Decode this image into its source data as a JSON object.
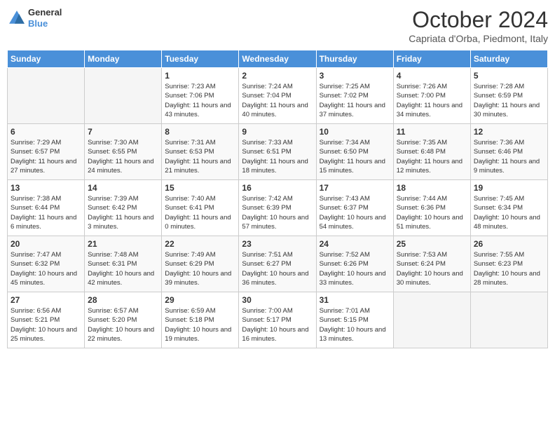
{
  "header": {
    "logo_line1": "General",
    "logo_line2": "Blue",
    "month_title": "October 2024",
    "subtitle": "Capriata d'Orba, Piedmont, Italy"
  },
  "days_of_week": [
    "Sunday",
    "Monday",
    "Tuesday",
    "Wednesday",
    "Thursday",
    "Friday",
    "Saturday"
  ],
  "weeks": [
    [
      {
        "day": null
      },
      {
        "day": null
      },
      {
        "day": 1,
        "sunrise": "7:23 AM",
        "sunset": "7:06 PM",
        "daylight": "11 hours and 43 minutes."
      },
      {
        "day": 2,
        "sunrise": "7:24 AM",
        "sunset": "7:04 PM",
        "daylight": "11 hours and 40 minutes."
      },
      {
        "day": 3,
        "sunrise": "7:25 AM",
        "sunset": "7:02 PM",
        "daylight": "11 hours and 37 minutes."
      },
      {
        "day": 4,
        "sunrise": "7:26 AM",
        "sunset": "7:00 PM",
        "daylight": "11 hours and 34 minutes."
      },
      {
        "day": 5,
        "sunrise": "7:28 AM",
        "sunset": "6:59 PM",
        "daylight": "11 hours and 30 minutes."
      }
    ],
    [
      {
        "day": 6,
        "sunrise": "7:29 AM",
        "sunset": "6:57 PM",
        "daylight": "11 hours and 27 minutes."
      },
      {
        "day": 7,
        "sunrise": "7:30 AM",
        "sunset": "6:55 PM",
        "daylight": "11 hours and 24 minutes."
      },
      {
        "day": 8,
        "sunrise": "7:31 AM",
        "sunset": "6:53 PM",
        "daylight": "11 hours and 21 minutes."
      },
      {
        "day": 9,
        "sunrise": "7:33 AM",
        "sunset": "6:51 PM",
        "daylight": "11 hours and 18 minutes."
      },
      {
        "day": 10,
        "sunrise": "7:34 AM",
        "sunset": "6:50 PM",
        "daylight": "11 hours and 15 minutes."
      },
      {
        "day": 11,
        "sunrise": "7:35 AM",
        "sunset": "6:48 PM",
        "daylight": "11 hours and 12 minutes."
      },
      {
        "day": 12,
        "sunrise": "7:36 AM",
        "sunset": "6:46 PM",
        "daylight": "11 hours and 9 minutes."
      }
    ],
    [
      {
        "day": 13,
        "sunrise": "7:38 AM",
        "sunset": "6:44 PM",
        "daylight": "11 hours and 6 minutes."
      },
      {
        "day": 14,
        "sunrise": "7:39 AM",
        "sunset": "6:42 PM",
        "daylight": "11 hours and 3 minutes."
      },
      {
        "day": 15,
        "sunrise": "7:40 AM",
        "sunset": "6:41 PM",
        "daylight": "11 hours and 0 minutes."
      },
      {
        "day": 16,
        "sunrise": "7:42 AM",
        "sunset": "6:39 PM",
        "daylight": "10 hours and 57 minutes."
      },
      {
        "day": 17,
        "sunrise": "7:43 AM",
        "sunset": "6:37 PM",
        "daylight": "10 hours and 54 minutes."
      },
      {
        "day": 18,
        "sunrise": "7:44 AM",
        "sunset": "6:36 PM",
        "daylight": "10 hours and 51 minutes."
      },
      {
        "day": 19,
        "sunrise": "7:45 AM",
        "sunset": "6:34 PM",
        "daylight": "10 hours and 48 minutes."
      }
    ],
    [
      {
        "day": 20,
        "sunrise": "7:47 AM",
        "sunset": "6:32 PM",
        "daylight": "10 hours and 45 minutes."
      },
      {
        "day": 21,
        "sunrise": "7:48 AM",
        "sunset": "6:31 PM",
        "daylight": "10 hours and 42 minutes."
      },
      {
        "day": 22,
        "sunrise": "7:49 AM",
        "sunset": "6:29 PM",
        "daylight": "10 hours and 39 minutes."
      },
      {
        "day": 23,
        "sunrise": "7:51 AM",
        "sunset": "6:27 PM",
        "daylight": "10 hours and 36 minutes."
      },
      {
        "day": 24,
        "sunrise": "7:52 AM",
        "sunset": "6:26 PM",
        "daylight": "10 hours and 33 minutes."
      },
      {
        "day": 25,
        "sunrise": "7:53 AM",
        "sunset": "6:24 PM",
        "daylight": "10 hours and 30 minutes."
      },
      {
        "day": 26,
        "sunrise": "7:55 AM",
        "sunset": "6:23 PM",
        "daylight": "10 hours and 28 minutes."
      }
    ],
    [
      {
        "day": 27,
        "sunrise": "6:56 AM",
        "sunset": "5:21 PM",
        "daylight": "10 hours and 25 minutes."
      },
      {
        "day": 28,
        "sunrise": "6:57 AM",
        "sunset": "5:20 PM",
        "daylight": "10 hours and 22 minutes."
      },
      {
        "day": 29,
        "sunrise": "6:59 AM",
        "sunset": "5:18 PM",
        "daylight": "10 hours and 19 minutes."
      },
      {
        "day": 30,
        "sunrise": "7:00 AM",
        "sunset": "5:17 PM",
        "daylight": "10 hours and 16 minutes."
      },
      {
        "day": 31,
        "sunrise": "7:01 AM",
        "sunset": "5:15 PM",
        "daylight": "10 hours and 13 minutes."
      },
      {
        "day": null
      },
      {
        "day": null
      }
    ]
  ]
}
